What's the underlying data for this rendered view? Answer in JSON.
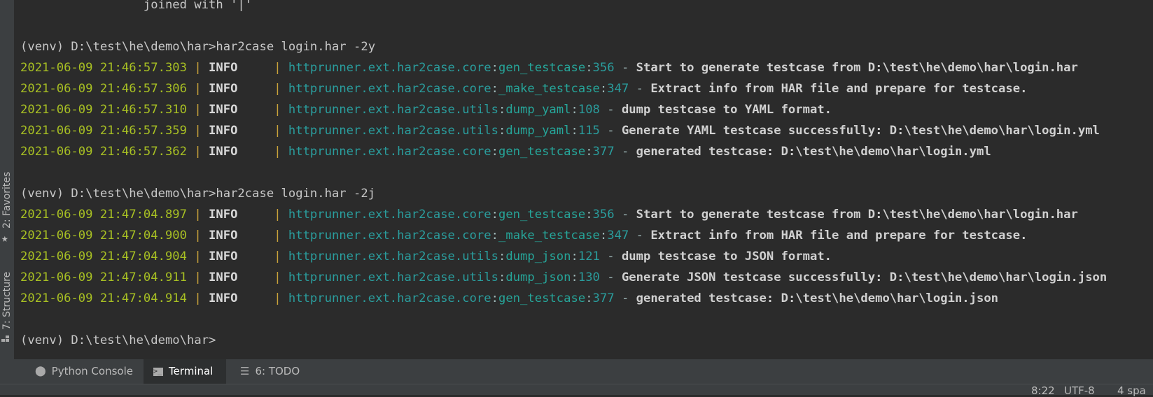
{
  "sidebar": {
    "favorites": "2: Favorites",
    "structure": "7: Structure"
  },
  "terminal": {
    "pre_text": "                 joined with '|'",
    "blocks": [
      {
        "prompt": "(venv) D:\\test\\he\\demo\\har>har2case login.har -2y",
        "logs": [
          {
            "date": "2021-06-09 21:46:57.303",
            "level": "INFO",
            "module": "httprunner.ext.har2case.core",
            "func": "gen_testcase",
            "lineno": "356",
            "message": "Start to generate testcase from D:\\test\\he\\demo\\har\\login.har"
          },
          {
            "date": "2021-06-09 21:46:57.306",
            "level": "INFO",
            "module": "httprunner.ext.har2case.core",
            "func": "_make_testcase",
            "lineno": "347",
            "message": "Extract info from HAR file and prepare for testcase."
          },
          {
            "date": "2021-06-09 21:46:57.310",
            "level": "INFO",
            "module": "httprunner.ext.har2case.utils",
            "func": "dump_yaml",
            "lineno": "108",
            "message": "dump testcase to YAML format."
          },
          {
            "date": "2021-06-09 21:46:57.359",
            "level": "INFO",
            "module": "httprunner.ext.har2case.utils",
            "func": "dump_yaml",
            "lineno": "115",
            "message": "Generate YAML testcase successfully: D:\\test\\he\\demo\\har\\login.yml"
          },
          {
            "date": "2021-06-09 21:46:57.362",
            "level": "INFO",
            "module": "httprunner.ext.har2case.core",
            "func": "gen_testcase",
            "lineno": "377",
            "message": "generated testcase: D:\\test\\he\\demo\\har\\login.yml"
          }
        ]
      },
      {
        "prompt": "(venv) D:\\test\\he\\demo\\har>har2case login.har -2j",
        "logs": [
          {
            "date": "2021-06-09 21:47:04.897",
            "level": "INFO",
            "module": "httprunner.ext.har2case.core",
            "func": "gen_testcase",
            "lineno": "356",
            "message": "Start to generate testcase from D:\\test\\he\\demo\\har\\login.har"
          },
          {
            "date": "2021-06-09 21:47:04.900",
            "level": "INFO",
            "module": "httprunner.ext.har2case.core",
            "func": "_make_testcase",
            "lineno": "347",
            "message": "Extract info from HAR file and prepare for testcase."
          },
          {
            "date": "2021-06-09 21:47:04.904",
            "level": "INFO",
            "module": "httprunner.ext.har2case.utils",
            "func": "dump_json",
            "lineno": "121",
            "message": "dump testcase to JSON format."
          },
          {
            "date": "2021-06-09 21:47:04.911",
            "level": "INFO",
            "module": "httprunner.ext.har2case.utils",
            "func": "dump_json",
            "lineno": "130",
            "message": "Generate JSON testcase successfully: D:\\test\\he\\demo\\har\\login.json"
          },
          {
            "date": "2021-06-09 21:47:04.914",
            "level": "INFO",
            "module": "httprunner.ext.har2case.core",
            "func": "gen_testcase",
            "lineno": "377",
            "message": "generated testcase: D:\\test\\he\\demo\\har\\login.json"
          }
        ]
      }
    ],
    "final_prompt": "(venv) D:\\test\\he\\demo\\har>"
  },
  "tabs": [
    {
      "label": "Python Console",
      "icon": "python-icon",
      "active": false
    },
    {
      "label": "Terminal",
      "icon": "terminal-icon",
      "active": true
    },
    {
      "label": "6: TODO",
      "icon": "list-icon",
      "active": false
    }
  ],
  "status": {
    "position": "8:22",
    "encoding": "UTF-8",
    "indent": "4 spa"
  },
  "colors": {
    "background": "#2b2b2b",
    "date": "#a8c023",
    "module": "#2a9d9d",
    "separator": "#c9a23a"
  }
}
